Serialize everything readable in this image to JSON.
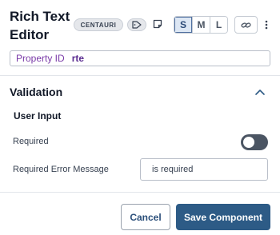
{
  "header": {
    "title": "Rich Text Editor",
    "badge_name": "CENTAURI",
    "tag_icon": "tag-icon",
    "note_icon": "sticky-note-icon",
    "sizes": [
      "S",
      "M",
      "L"
    ],
    "selected_size": "S",
    "link_icon": "link-icon",
    "more_icon": "vertical-ellipsis-icon"
  },
  "property_id": {
    "label": "Property ID",
    "value": "rte"
  },
  "validation": {
    "title": "Validation",
    "collapse_icon": "chevron-up-icon",
    "subsection": "User Input",
    "required_label": "Required",
    "required_enabled": false,
    "error_message_label": "Required Error Message",
    "error_message_value": "is required"
  },
  "footer": {
    "cancel_label": "Cancel",
    "save_label": "Save Component"
  },
  "colors": {
    "primary": "#2d5b86",
    "property_label": "#7a3aa8",
    "toggle_off": "#4b5563"
  }
}
